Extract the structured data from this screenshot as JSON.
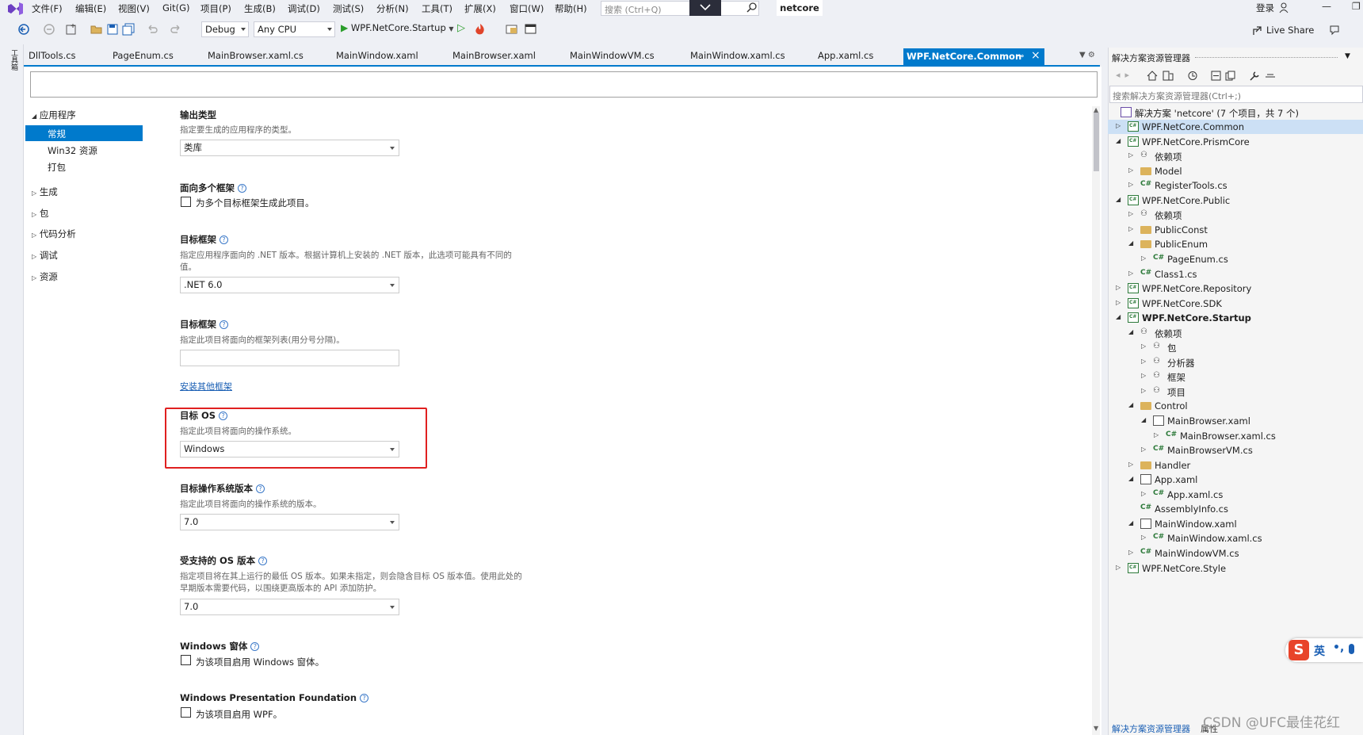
{
  "menu": {
    "items": [
      "文件(F)",
      "编辑(E)",
      "视图(V)",
      "Git(G)",
      "项目(P)",
      "生成(B)",
      "调试(D)",
      "测试(S)",
      "分析(N)",
      "工具(T)",
      "扩展(X)",
      "窗口(W)",
      "帮助(H)"
    ],
    "search_placeholder": "搜索 (Ctrl+Q)",
    "solution_name": "netcore",
    "login": "登录"
  },
  "toolbar": {
    "config": "Debug",
    "platform": "Any CPU",
    "startup": "WPF.NetCore.Startup",
    "live_share": "Live Share"
  },
  "left_strip": {
    "label": "工具箱"
  },
  "tabs": {
    "items": [
      "DllTools.cs",
      "PageEnum.cs",
      "MainBrowser.xaml.cs",
      "MainWindow.xaml",
      "MainBrowser.xaml",
      "MainWindowVM.cs",
      "MainWindow.xaml.cs",
      "App.xaml.cs"
    ],
    "active": "WPF.NetCore.Common"
  },
  "nav": {
    "app_header": "应用程序",
    "app_items": [
      "常规",
      "Win32 资源",
      "打包"
    ],
    "other": [
      "生成",
      "包",
      "代码分析",
      "调试",
      "资源"
    ]
  },
  "props": {
    "output_type": {
      "title": "输出类型",
      "desc": "指定要生成的应用程序的类型。",
      "value": "类库"
    },
    "multi_target": {
      "title": "面向多个框架",
      "check": "为多个目标框架生成此项目。"
    },
    "target_fw": {
      "title": "目标框架",
      "desc1": "指定应用程序面向的 .NET 版本。根据计算机上安装的 .NET 版本，此选项可能具有不同的",
      "desc2": "值。",
      "value": ".NET 6.0"
    },
    "target_fws": {
      "title": "目标框架",
      "desc": "指定此项目将面向的框架列表(用分号分隔)。",
      "link": "安装其他框架"
    },
    "target_os": {
      "title": "目标 OS",
      "desc": "指定此项目将面向的操作系统。",
      "value": "Windows"
    },
    "target_os_ver": {
      "title": "目标操作系统版本",
      "desc": "指定此项目将面向的操作系统的版本。",
      "value": "7.0"
    },
    "supported_os": {
      "title": "受支持的 OS 版本",
      "desc1": "指定项目将在其上运行的最低 OS 版本。如果未指定，则会隐含目标 OS 版本值。使用此处的",
      "desc2": "早期版本需要代码，以围绕更高版本的 API 添加防护。",
      "value": "7.0"
    },
    "winforms": {
      "title": "Windows 窗体",
      "check": "为该项目启用 Windows 窗体。"
    },
    "wpf": {
      "title": "Windows Presentation Foundation",
      "check": "为该项目启用 WPF。"
    }
  },
  "solution_explorer": {
    "title": "解决方案资源管理器",
    "search_placeholder": "搜索解决方案资源管理器(Ctrl+;)",
    "solution": "解决方案 'netcore' (7 个项目，共 7 个)",
    "nodes": [
      {
        "label": "WPF.NetCore.Common",
        "level": 0,
        "type": "proj",
        "caret": "closed",
        "selected": true
      },
      {
        "label": "WPF.NetCore.PrismCore",
        "level": 0,
        "type": "proj",
        "caret": "open"
      },
      {
        "label": "依赖项",
        "level": 1,
        "type": "dep",
        "caret": "closed"
      },
      {
        "label": "Model",
        "level": 1,
        "type": "folder",
        "caret": "closed"
      },
      {
        "label": "RegisterTools.cs",
        "level": 1,
        "type": "cs",
        "caret": "closed"
      },
      {
        "label": "WPF.NetCore.Public",
        "level": 0,
        "type": "proj",
        "caret": "open"
      },
      {
        "label": "依赖项",
        "level": 1,
        "type": "dep",
        "caret": "closed"
      },
      {
        "label": "PublicConst",
        "level": 1,
        "type": "folder",
        "caret": "closed"
      },
      {
        "label": "PublicEnum",
        "level": 1,
        "type": "folder",
        "caret": "open"
      },
      {
        "label": "PageEnum.cs",
        "level": 2,
        "type": "cs",
        "caret": "closed"
      },
      {
        "label": "Class1.cs",
        "level": 1,
        "type": "cs",
        "caret": "closed"
      },
      {
        "label": "WPF.NetCore.Repository",
        "level": 0,
        "type": "proj",
        "caret": "closed"
      },
      {
        "label": "WPF.NetCore.SDK",
        "level": 0,
        "type": "proj",
        "caret": "closed"
      },
      {
        "label": "WPF.NetCore.Startup",
        "level": 0,
        "type": "proj",
        "caret": "open",
        "bold": true
      },
      {
        "label": "依赖项",
        "level": 1,
        "type": "dep",
        "caret": "open"
      },
      {
        "label": "包",
        "level": 2,
        "type": "dep",
        "caret": "closed"
      },
      {
        "label": "分析器",
        "level": 2,
        "type": "dep",
        "caret": "closed"
      },
      {
        "label": "框架",
        "level": 2,
        "type": "dep",
        "caret": "closed"
      },
      {
        "label": "项目",
        "level": 2,
        "type": "dep",
        "caret": "closed"
      },
      {
        "label": "Control",
        "level": 1,
        "type": "folder",
        "caret": "open"
      },
      {
        "label": "MainBrowser.xaml",
        "level": 2,
        "type": "xaml",
        "caret": "open"
      },
      {
        "label": "MainBrowser.xaml.cs",
        "level": 3,
        "type": "cs",
        "caret": "closed"
      },
      {
        "label": "MainBrowserVM.cs",
        "level": 2,
        "type": "cs",
        "caret": "closed"
      },
      {
        "label": "Handler",
        "level": 1,
        "type": "folder",
        "caret": "closed"
      },
      {
        "label": "App.xaml",
        "level": 1,
        "type": "xaml",
        "caret": "open"
      },
      {
        "label": "App.xaml.cs",
        "level": 2,
        "type": "cs",
        "caret": "closed"
      },
      {
        "label": "AssemblyInfo.cs",
        "level": 1,
        "type": "cs",
        "caret": "none"
      },
      {
        "label": "MainWindow.xaml",
        "level": 1,
        "type": "xaml",
        "caret": "open"
      },
      {
        "label": "MainWindow.xaml.cs",
        "level": 2,
        "type": "cs",
        "caret": "closed"
      },
      {
        "label": "MainWindowVM.cs",
        "level": 1,
        "type": "cs",
        "caret": "closed"
      },
      {
        "label": "WPF.NetCore.Style",
        "level": 0,
        "type": "proj",
        "caret": "closed"
      }
    ],
    "bottom_tab_active": "解决方案资源管理器",
    "bottom_tab": "属性"
  },
  "ime": {
    "label": "英"
  },
  "watermark": "CSDN @UFC最佳花红",
  "colors": {
    "accent": "#007acc",
    "highlight": "#e02020"
  }
}
